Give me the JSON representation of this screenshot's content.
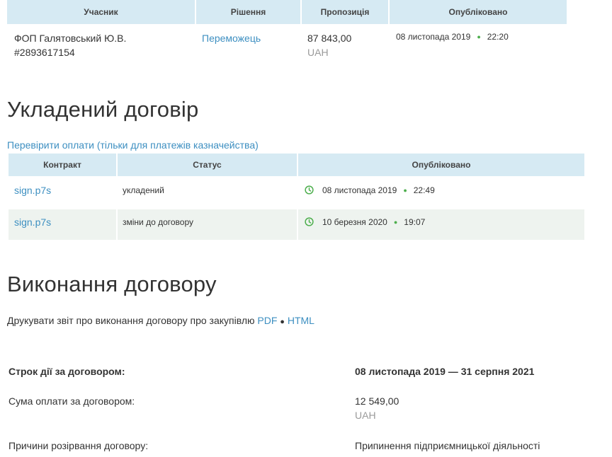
{
  "bids_table": {
    "headers": [
      "Учасник",
      "Рішення",
      "Пропозиція",
      "Опубліковано"
    ],
    "row": {
      "participant_name": "ФОП Галятовський Ю.В.",
      "participant_id": "#2893617154",
      "decision": "Переможець",
      "amount": "87 843,00",
      "currency": "UAH",
      "date": "08 листопада 2019",
      "time": "22:20"
    }
  },
  "contract_section": {
    "title": "Укладений договір",
    "check_payments_link": "Перевірити оплати (тільки для платежів казначейства)",
    "headers": [
      "Контракт",
      "Статус",
      "Опубліковано"
    ],
    "rows": [
      {
        "file": "sign.p7s",
        "status": "укладений",
        "date": "08 листопада 2019",
        "time": "22:49",
        "icon": "clock-icon"
      },
      {
        "file": "sign.p7s",
        "status": "зміни до договору",
        "date": "10 березня 2020",
        "time": "19:07",
        "icon": "clock-icon"
      }
    ]
  },
  "execution_section": {
    "title": "Виконання договору",
    "print_text": "Друкувати звіт про виконання договору про закупівлю",
    "pdf_link": "PDF",
    "separator": "●",
    "html_link": "HTML",
    "term_label": "Строк дії за договором:",
    "term_value": "08 листопада 2019 — 31 серпня 2021",
    "payment_label": "Сума оплати за договором:",
    "payment_value": "12 549,00",
    "payment_currency": "UAH",
    "termination_label": "Причини розірвання договору:",
    "termination_value": "Припинення підприємницької діяльності"
  },
  "colors": {
    "header_bg": "#d6eaf3",
    "link": "#3d8fc1",
    "accent_green": "#4cae4c",
    "alt_row": "#eef3ef"
  }
}
